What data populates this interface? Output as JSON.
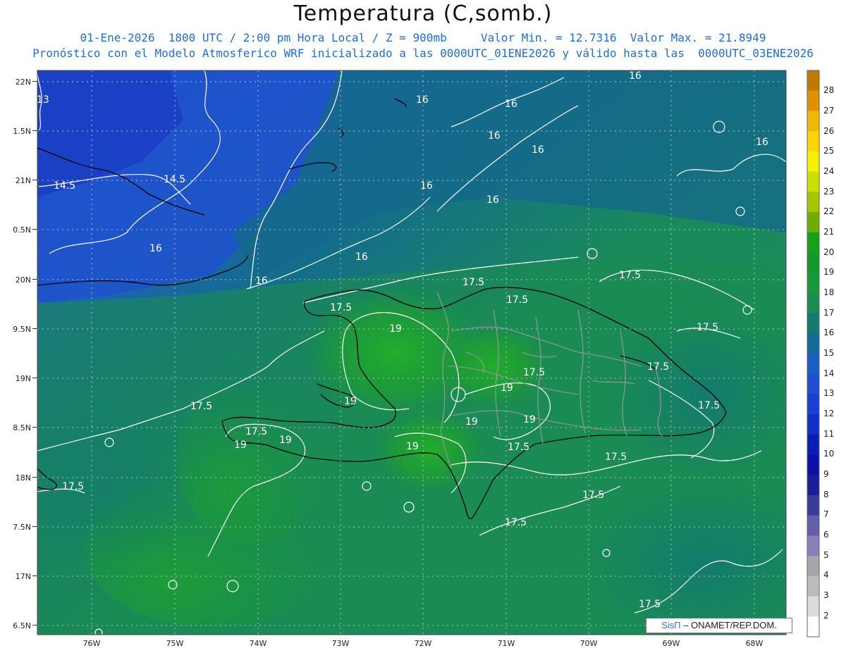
{
  "header": {
    "title": "Temperatura (C,somb.)",
    "line1": "01-Ene-2026  1800 UTC / 2:00 pm Hora Local / Z = 900mb     Valor Min. = 12.7316  Valor Max. = 21.8949",
    "line2": "Pronóstico con el Modelo Atmosferico WRF inicializado a las 0000UTC_01ENE2026 y válido hasta las  0000UTC_03ENE2026"
  },
  "map": {
    "lat_ticks": [
      "22N",
      "1.5N",
      "21N",
      "0.5N",
      "20N",
      "9.5N",
      "19N",
      "8.5N",
      "18N",
      "7.5N",
      "17N",
      "6.5N"
    ],
    "lon_ticks": [
      "76W",
      "75W",
      "74W",
      "73W",
      "72W",
      "71W",
      "70W",
      "69W",
      "68W"
    ],
    "contour_labels": [
      "13",
      "14.5",
      "14.5",
      "16",
      "16",
      "16",
      "16",
      "16",
      "16",
      "16",
      "16",
      "16",
      "16",
      "16",
      "17.5",
      "17.5",
      "17.5",
      "17.5",
      "17.5",
      "17.5",
      "17.5",
      "17.5",
      "17.5",
      "17.5",
      "17.5",
      "17.5",
      "17.5",
      "17.5",
      "17.5",
      "17.5",
      "19",
      "19",
      "19",
      "19",
      "19",
      "19",
      "19",
      "19"
    ],
    "colors": {
      "cold": "#1f4fd0",
      "mid": "#12747a",
      "warm": "#1fa032",
      "contour": "#ffffff",
      "coast": "#000000",
      "province": "#9a9a9a"
    }
  },
  "colorbar": {
    "labels": [
      "28",
      "27",
      "26",
      "25",
      "24",
      "23",
      "22",
      "21",
      "20",
      "19",
      "18",
      "17",
      "16",
      "15",
      "14",
      "13",
      "12",
      "11",
      "10",
      "9",
      "8",
      "7",
      "6",
      "5",
      "4",
      "3",
      "2"
    ],
    "colors": [
      "#c07a00",
      "#e09000",
      "#f0b800",
      "#ffd400",
      "#f5f200",
      "#cbe000",
      "#a3c800",
      "#6fae00",
      "#18a018",
      "#139a2a",
      "#17983c",
      "#1a8e50",
      "#127a70",
      "#166a9a",
      "#1a5fc4",
      "#1d4fd0",
      "#1a3fd4",
      "#1030c8",
      "#0a1eb6",
      "#0c12a6",
      "#1a1e98",
      "#3a3a9a",
      "#605fa8",
      "#8a80b8",
      "#a6a6ac",
      "#bcbcbc",
      "#dcdcdc",
      "#ffffff"
    ]
  },
  "credit": {
    "brand": "SisΠ",
    "text": "– ONAMET/REP.DOM."
  }
}
